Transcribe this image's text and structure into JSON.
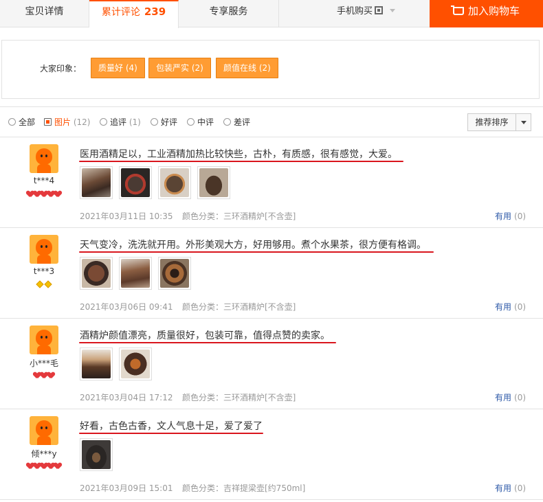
{
  "tabs": [
    {
      "label": "宝贝详情"
    },
    {
      "label": "累计评论",
      "count": "239"
    },
    {
      "label": "专享服务"
    }
  ],
  "mobile_buy": "手机购买",
  "add_to_cart": "加入购物车",
  "impressions": {
    "label": "大家印象：",
    "tags": [
      "质量好 (4)",
      "包装严实 (2)",
      "颜值在线 (2)"
    ]
  },
  "filters": {
    "all": "全部",
    "pictures": "图片",
    "pictures_count": "(12)",
    "followup": "追评",
    "followup_count": "(1)",
    "good": "好评",
    "neutral": "中评",
    "bad": "差评",
    "selected": "pictures"
  },
  "sort": {
    "label": "推荐排序"
  },
  "reviews": [
    {
      "user": "t***4",
      "badge": "5 hearts",
      "text": "医用酒精足以，工业酒精加热比较快些，古朴，有质感，很有感觉，大爱。",
      "date": "2021年03月11日 10:35",
      "sku": "颜色分类：三环酒精炉[不含壶]",
      "useful_label": "有用",
      "useful_count": "(0)"
    },
    {
      "user": "t***3",
      "badge": "2 diamonds",
      "text": "天气变冷，洗洗就开用。外形美观大方，好用够用。煮个水果茶，很方便有格调。",
      "date": "2021年03月06日 09:41",
      "sku": "颜色分类：三环酒精炉[不含壶]",
      "useful_label": "有用",
      "useful_count": "(0)"
    },
    {
      "user": "小***毛",
      "badge": "3 hearts",
      "text": "酒精炉颜值漂亮，质量很好，包装可靠，值得点赞的卖家。",
      "date": "2021年03月04日 17:12",
      "sku": "颜色分类：三环酒精炉[不含壶]",
      "useful_label": "有用",
      "useful_count": "(0)"
    },
    {
      "user": "倾***y",
      "badge": "5 hearts",
      "text": "好看，古色古香，文人气息十足，爱了爱了",
      "date": "2021年03月09日 15:01",
      "sku": "颜色分类：吉祥提梁壶[约750ml]",
      "useful_label": "有用",
      "useful_count": "(0)"
    }
  ],
  "colors": {
    "accent": "#ff5000",
    "tag_bg": "#ff9c33",
    "link": "#2e5aa8",
    "underline": "#d9151d"
  }
}
